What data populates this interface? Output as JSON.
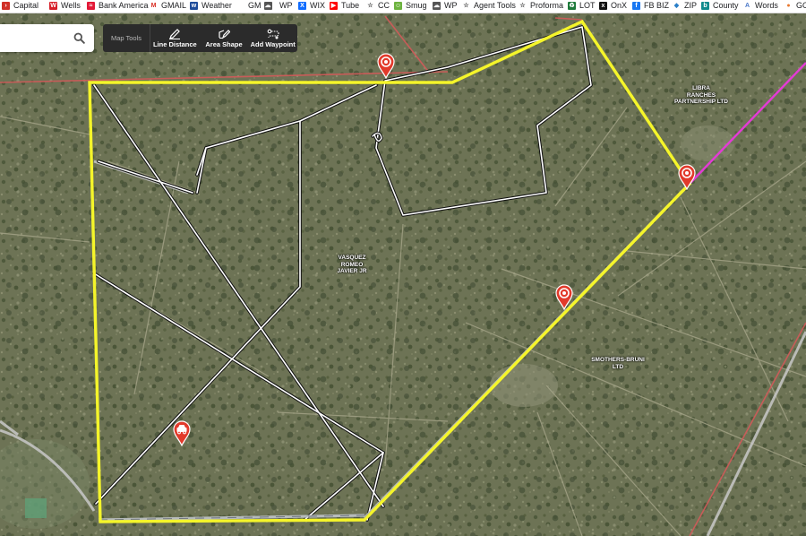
{
  "bookmarks": [
    {
      "label": "Capital",
      "icon": "capital-one-icon"
    },
    {
      "label": "Wells",
      "icon": "wells-fargo-icon"
    },
    {
      "label": "Bank America",
      "icon": "bank-of-america-icon"
    },
    {
      "label": "GMAIL",
      "icon": "gmail-icon"
    },
    {
      "label": "Weather",
      "icon": "weather-icon"
    },
    {
      "label": "GM",
      "icon": "cloud-icon"
    },
    {
      "label": "WP",
      "icon": "cloud-icon"
    },
    {
      "label": "WIX",
      "icon": "wix-icon"
    },
    {
      "label": "Tube",
      "icon": "youtube-icon"
    },
    {
      "label": "CC",
      "icon": "star-icon"
    },
    {
      "label": "Smug",
      "icon": "smugmug-icon"
    },
    {
      "label": "WP",
      "icon": "cloud-icon"
    },
    {
      "label": "Agent Tools",
      "icon": "star-icon"
    },
    {
      "label": "Proforma",
      "icon": "star-icon"
    },
    {
      "label": "LOT",
      "icon": "recycle-icon"
    },
    {
      "label": "OnX",
      "icon": "onx-icon"
    },
    {
      "label": "FB BIZ",
      "icon": "facebook-icon"
    },
    {
      "label": "ZIP",
      "icon": "zip-icon"
    },
    {
      "label": "County",
      "icon": "bing-icon"
    },
    {
      "label": "Words",
      "icon": "words-icon"
    },
    {
      "label": "GO",
      "icon": "go-icon"
    }
  ],
  "search": {
    "placeholder": "",
    "value": ""
  },
  "map_tools": {
    "title": "Map Tools",
    "tools": [
      {
        "label": "Line Distance",
        "icon": "pencil-icon"
      },
      {
        "label": "Area Shape",
        "icon": "area-shape-icon"
      },
      {
        "label": "Add Waypoint",
        "icon": "waypoint-icon"
      }
    ]
  },
  "parcel_labels": [
    {
      "text": "LIBRA\nRANCHES\nPARTNERSHIP LTD"
    },
    {
      "text": "VASQUEZ\nROMEO\nJAVIER JR"
    },
    {
      "text": "SMOTHERS-BRUNI\nLTD"
    }
  ],
  "markers": [
    {
      "type": "target-waypoint"
    },
    {
      "type": "target-waypoint"
    },
    {
      "type": "target-waypoint"
    },
    {
      "type": "vehicle-waypoint"
    }
  ],
  "colors": {
    "boundary": "#f5f52a",
    "property_line": "#e0456b",
    "magenta_line": "#e43ad6",
    "marker": "#e23a2b",
    "toolbar": "#2b2b2b"
  }
}
